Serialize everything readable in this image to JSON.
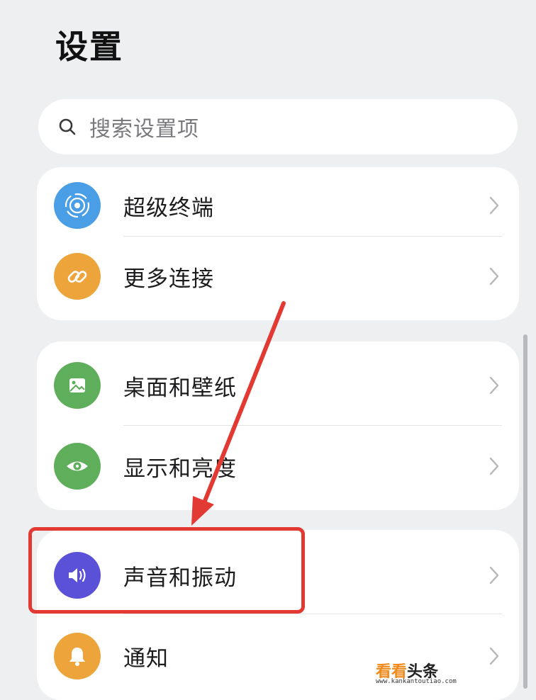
{
  "header": {
    "title": "设置"
  },
  "search": {
    "placeholder": "搜索设置项",
    "icon": "search-icon"
  },
  "groups": [
    {
      "items": [
        {
          "label": "超级终端",
          "icon": "super-device-icon",
          "color": "#4a9ee6"
        },
        {
          "label": "更多连接",
          "icon": "link-icon",
          "color": "#eda53b"
        }
      ]
    },
    {
      "items": [
        {
          "label": "桌面和壁纸",
          "icon": "wallpaper-icon",
          "color": "#5fae5b"
        },
        {
          "label": "显示和亮度",
          "icon": "eye-icon",
          "color": "#5fae5b"
        }
      ]
    },
    {
      "items": [
        {
          "label": "声音和振动",
          "icon": "speaker-icon",
          "color": "#5b51d8"
        },
        {
          "label": "通知",
          "icon": "bell-icon",
          "color": "#eda53b"
        }
      ]
    }
  ],
  "annotation": {
    "highlight_color": "#e23a33",
    "target": "声音和振动"
  },
  "watermark": {
    "brand_a": "看看",
    "brand_b": "头条",
    "url": "www.kankantoutiao.com"
  }
}
